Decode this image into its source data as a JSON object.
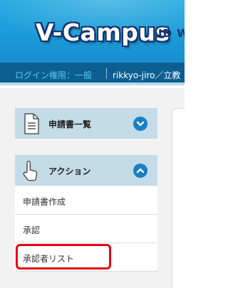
{
  "header": {
    "logo_text": "V-Campus",
    "logo_subtext": "ID W"
  },
  "infobar": {
    "permission": "ログイン権限：一般",
    "user": "rikkyo-jiro／立教"
  },
  "menu": {
    "sections": [
      {
        "label": "申請書一覧",
        "icon": "document-icon",
        "state": "collapsed"
      },
      {
        "label": "アクション",
        "icon": "hand-pointer-icon",
        "state": "expanded"
      }
    ],
    "action_items": [
      {
        "label": "申請書作成"
      },
      {
        "label": "承認"
      },
      {
        "label": "承認者リスト"
      }
    ]
  },
  "colors": {
    "header": "#1b9ad8",
    "infobar": "#0d5f93",
    "menu_header": "#c4dbe8",
    "toggle": "#1a7fc4",
    "highlight": "#e60012"
  }
}
